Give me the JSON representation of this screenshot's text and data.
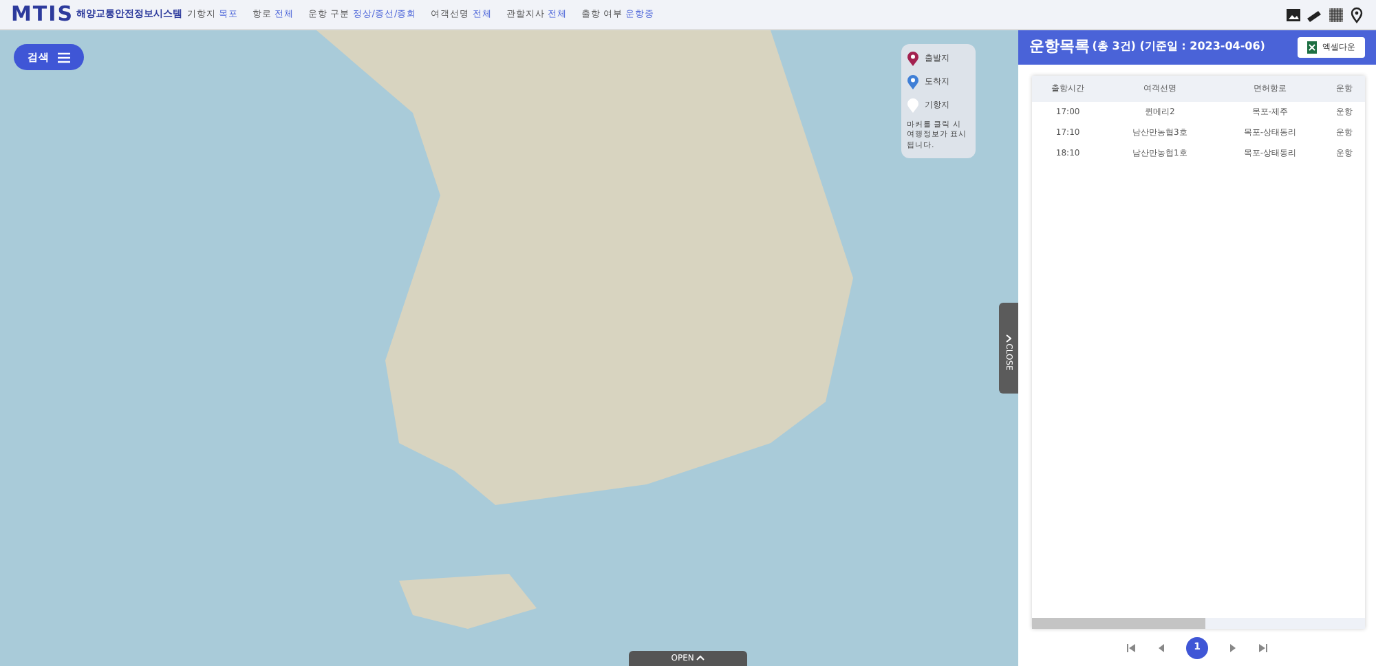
{
  "header": {
    "logo": "MTIS",
    "system_name": "해양교통안전정보시스템",
    "filters": [
      {
        "label": "기항지",
        "value": "목포"
      },
      {
        "label": "항로",
        "value": "전체"
      },
      {
        "label": "운항 구분",
        "value": "정상/증선/증회"
      },
      {
        "label": "여객선명",
        "value": "전체"
      },
      {
        "label": "관할지사",
        "value": "전체"
      },
      {
        "label": "출항 여부",
        "value": "운항중"
      }
    ]
  },
  "search_button": {
    "label": "검색"
  },
  "legend": {
    "items": [
      {
        "label": "출발지",
        "color": "#a3214f"
      },
      {
        "label": "도착지",
        "color": "#3f7fd6"
      },
      {
        "label": "기항지",
        "color": "#ffffff"
      }
    ],
    "note": "마커를 클릭 시 여행정보가 표시됩니다."
  },
  "open_tab": {
    "label": "OPEN"
  },
  "close_tab": {
    "label": "CLOSE"
  },
  "panel": {
    "title": "운항목록",
    "summary": "(총 3건) (기준일 : 2023-04-06)",
    "excel_button": "엑셀다운",
    "table": {
      "columns": [
        "출항시간",
        "여객선명",
        "면허항로",
        "운항"
      ],
      "rows": [
        [
          "17:00",
          "퀸메리2",
          "목포-제주",
          "운항"
        ],
        [
          "17:10",
          "남산만농협3호",
          "목포-상태동리",
          "운항"
        ],
        [
          "18:10",
          "남산만농협1호",
          "목포-상태동리",
          "운항"
        ]
      ]
    },
    "pagination": {
      "pages": [
        {
          "label": "1",
          "selected": true
        }
      ]
    }
  }
}
